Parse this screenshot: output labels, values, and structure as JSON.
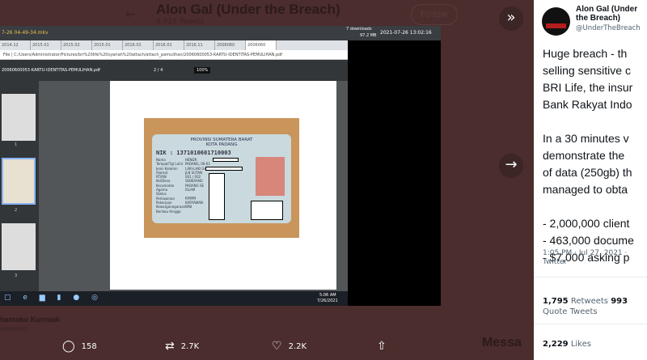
{
  "background": {
    "title": "Alon Gal (Under the Breach)",
    "tweets": "4,825 Tweets",
    "follow": "Follow",
    "reply_name": "hantoko Kurniadi",
    "reply_handle": "yesiman",
    "messages": "Messa"
  },
  "video": {
    "filename": "7-26 04-49-34.mkv",
    "downloads": "7 downloads",
    "size": "97.2 MB",
    "datetime": "2021-07-26 13:02:16",
    "tabs": [
      "2014.12",
      "2015.01",
      "2015.02",
      "2015.01",
      "2016.02",
      "2016.01",
      "2016.11",
      "2006060",
      "2006060"
    ],
    "address": "File | C:/Users/Administrator/Pictures/bri%20life%20syariah%20attach/attach_pemulihan/20060600053-KARTU-IDENTITAS-PEMULIHAN.pdf",
    "pdf_title": "20060600053-KARTU-IDENTITAS-PEMULIHAN.pdf",
    "page": "2",
    "pages": "4",
    "zoom": "100%",
    "thumb_labels": [
      "1",
      "2",
      "3"
    ],
    "card": {
      "province": "PROVINSI SUMATERA BARAT",
      "city": "KOTA PADANG",
      "nik_label": "NIK",
      "nik": ": 1371010601710003",
      "fields": [
        [
          "Nama",
          "HENDR"
        ],
        [
          "Tempat/Tgl Lahir",
          "PADANG, 06-01"
        ],
        [
          "Jenis Kelamin",
          "LAKI-LAKI   Gol. Darah : O"
        ],
        [
          "Alamat",
          "JLN SUTAN"
        ],
        [
          "RT/RW",
          "001 / 002"
        ],
        [
          "Kel/Desa",
          "SEBERANG"
        ],
        [
          "Kecamatan",
          "PADANG SE"
        ],
        [
          "Agama",
          "ISLAM"
        ],
        [
          "Status Perkawinan",
          "KAWIN"
        ],
        [
          "Pekerjaan",
          "KARYAWAN"
        ],
        [
          "Kewarganegaraan",
          "WNI"
        ],
        [
          "Berlaku Hingga",
          ""
        ]
      ]
    },
    "clock_time": "5:06 AM",
    "clock_date": "7/26/2021"
  },
  "actions": {
    "replies": "158",
    "retweets": "2.7K",
    "likes": "2.2K"
  },
  "tweet": {
    "name": "Alon Gal (Under the Breach)",
    "handle": "@UnderTheBreach",
    "text": "Huge breach - th\nselling sensitive c\nBRI Life, the insur\nBank Rakyat Indo\n\nIn a 30 minutes v\ndemonstrate the\nof data (250gb) th\nmanaged to obta\n\n- 2,000,000 client\n- 463,000 docume\n- $7,000 asking p",
    "time": "1:05 PM · Jul 27, 2021 · Twitter",
    "retweets": "1,795",
    "retweets_label": "Retweets",
    "quotes": "993",
    "quotes_label": "Quote Tweets",
    "likes": "2,229",
    "likes_label": "Likes"
  },
  "icons": {
    "next": "chevron-right-icon",
    "collapse": "double-chevron-right-icon"
  }
}
